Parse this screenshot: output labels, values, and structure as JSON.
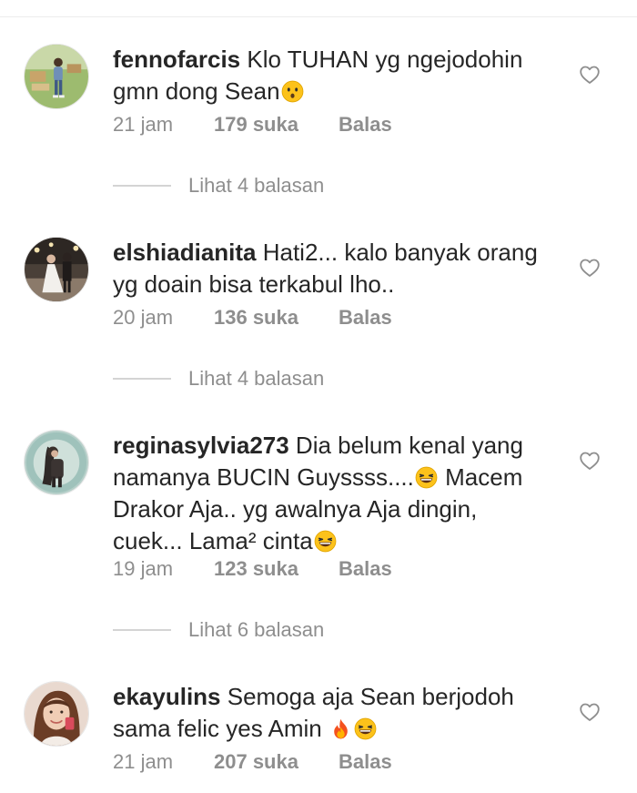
{
  "comments": [
    {
      "username": "fennofarcis",
      "text_segments": [
        " Klo TUHAN yg ngejodohin gmn dong Sean",
        "",
        ""
      ],
      "emojis": [
        "hushed-face-emoji"
      ],
      "time": "21 jam",
      "likes": "179 suka",
      "reply_label": "Balas",
      "replies_label": "Lihat 4 balasan",
      "liked": false
    },
    {
      "username": "elshiadianita",
      "text_segments": [
        " Hati2... kalo banyak orang yg doain bisa terkabul lho..",
        "",
        ""
      ],
      "emojis": [],
      "time": "20 jam",
      "likes": "136 suka",
      "reply_label": "Balas",
      "replies_label": "Lihat 4 balasan",
      "liked": false
    },
    {
      "username": "reginasylvia273",
      "text_segments": [
        " Dia belum kenal yang namanya BUCIN Guyssss....",
        " Macem Drakor Aja.. yg awalnya Aja dingin, cuek... Lama² cinta",
        ""
      ],
      "emojis": [
        "grinning-squinting-face-emoji",
        "grinning-squinting-face-emoji"
      ],
      "time": "19 jam",
      "likes": "123 suka",
      "reply_label": "Balas",
      "replies_label": "Lihat 6 balasan",
      "liked": false
    },
    {
      "username": "ekayulins",
      "text_segments": [
        " Semoga aja Sean berjodoh sama felic yes Amin ",
        "",
        ""
      ],
      "emojis": [
        "fire-emoji",
        "grinning-squinting-face-emoji"
      ],
      "time": "21 jam",
      "likes": "207 suka",
      "reply_label": "Balas",
      "replies_label": "",
      "liked": false
    }
  ],
  "colors": {
    "text_primary": "#262626",
    "text_secondary": "#8e8e8e",
    "divider": "#d4d4d4",
    "background": "#ffffff"
  },
  "icons": {
    "like": "heart-outline-icon"
  }
}
